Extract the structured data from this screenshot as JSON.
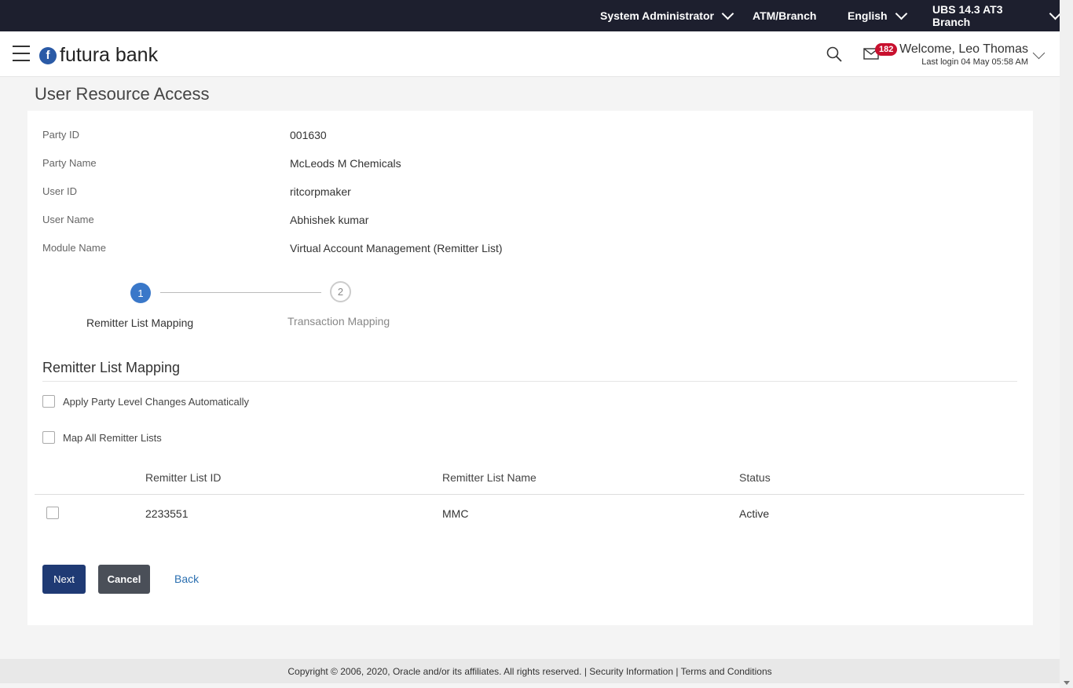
{
  "topbar": {
    "role": "System Administrator",
    "atm_branch": "ATM/Branch",
    "language": "English",
    "entity": "UBS 14.3 AT3 Branch"
  },
  "header": {
    "logo_mark": "f",
    "logo_text": "futura bank",
    "notifications_count": "182",
    "welcome": "Welcome, Leo Thomas",
    "last_login": "Last login 04 May 05:58 AM"
  },
  "page": {
    "title": "User Resource Access"
  },
  "details": [
    {
      "label": "Party ID",
      "value": "001630"
    },
    {
      "label": "Party Name",
      "value": "McLeods M Chemicals"
    },
    {
      "label": "User ID",
      "value": "ritcorpmaker"
    },
    {
      "label": "User Name",
      "value": "Abhishek kumar"
    },
    {
      "label": "Module Name",
      "value": "Virtual Account Management (Remitter List)"
    }
  ],
  "steps": [
    {
      "number": "1",
      "label": "Remitter List Mapping",
      "active": true
    },
    {
      "number": "2",
      "label": "Transaction Mapping",
      "active": false
    }
  ],
  "section": {
    "title": "Remitter List Mapping",
    "apply_party_level": "Apply Party Level Changes Automatically",
    "map_all": "Map All Remitter Lists"
  },
  "table": {
    "headers": [
      "Remitter List ID",
      "Remitter List Name",
      "Status"
    ],
    "rows": [
      {
        "id": "2233551",
        "name": "MMC",
        "status": "Active"
      }
    ]
  },
  "buttons": {
    "next": "Next",
    "cancel": "Cancel",
    "back": "Back"
  },
  "footer": {
    "copyright": "Copyright © 2006, 2020, Oracle and/or its affiliates. All rights reserved. | Security Information | Terms and Conditions"
  },
  "colors": {
    "brand": "#1d1f2e",
    "primary_button": "#1f3a74",
    "step_active": "#3a78c9",
    "badge": "#c8102e"
  }
}
